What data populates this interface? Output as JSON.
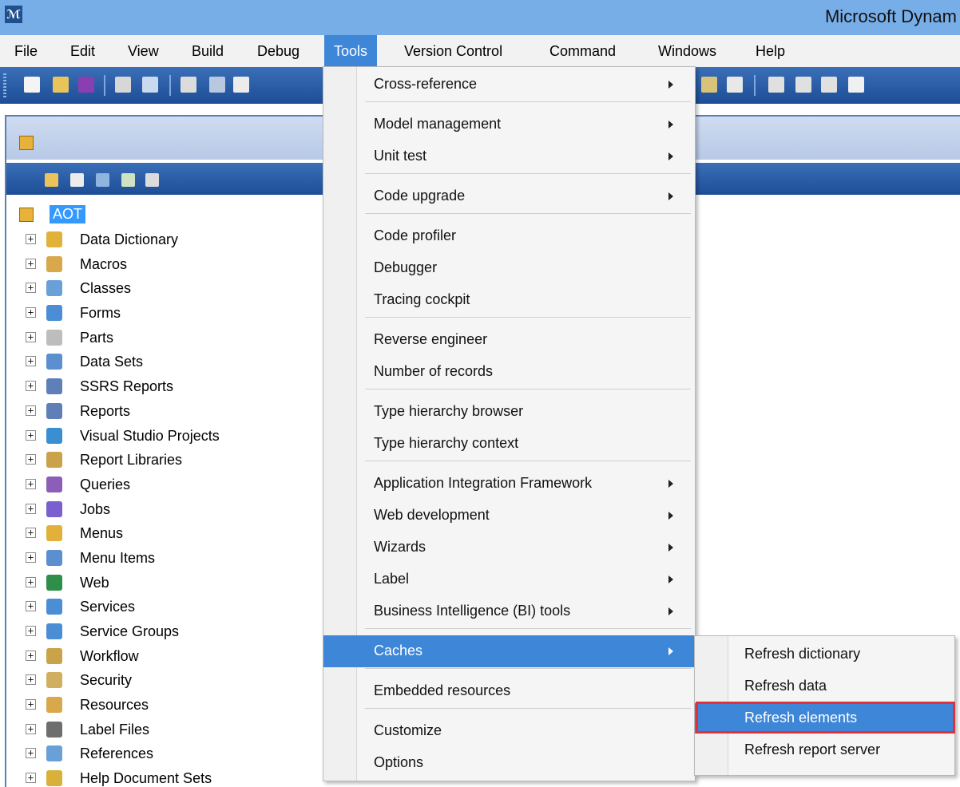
{
  "window": {
    "title": "Microsoft Dynam"
  },
  "menubar": [
    "File",
    "Edit",
    "View",
    "Build",
    "Debug",
    "Tools",
    "Version Control",
    "Command",
    "Windows",
    "Help"
  ],
  "aot": {
    "root_label": "AOT",
    "nodes": [
      {
        "label": "Data Dictionary",
        "icon": "database-icon"
      },
      {
        "label": "Macros",
        "icon": "macros-icon"
      },
      {
        "label": "Classes",
        "icon": "classes-icon"
      },
      {
        "label": "Forms",
        "icon": "forms-icon"
      },
      {
        "label": "Parts",
        "icon": "parts-icon"
      },
      {
        "label": "Data Sets",
        "icon": "data-sets-icon"
      },
      {
        "label": "SSRS Reports",
        "icon": "ssrs-reports-icon"
      },
      {
        "label": "Reports",
        "icon": "reports-icon"
      },
      {
        "label": "Visual Studio Projects",
        "icon": "visual-studio-icon"
      },
      {
        "label": "Report Libraries",
        "icon": "report-libraries-icon"
      },
      {
        "label": "Queries",
        "icon": "queries-icon"
      },
      {
        "label": "Jobs",
        "icon": "jobs-icon"
      },
      {
        "label": "Menus",
        "icon": "menus-icon"
      },
      {
        "label": "Menu Items",
        "icon": "menu-items-icon"
      },
      {
        "label": "Web",
        "icon": "globe-icon"
      },
      {
        "label": "Services",
        "icon": "services-icon"
      },
      {
        "label": "Service Groups",
        "icon": "service-groups-icon"
      },
      {
        "label": "Workflow",
        "icon": "workflow-icon"
      },
      {
        "label": "Security",
        "icon": "security-icon"
      },
      {
        "label": "Resources",
        "icon": "resources-icon"
      },
      {
        "label": "Label Files",
        "icon": "label-files-icon"
      },
      {
        "label": "References",
        "icon": "references-icon"
      },
      {
        "label": "Help Document Sets",
        "icon": "help-documents-icon"
      }
    ]
  },
  "tools_menu": {
    "items": [
      {
        "label": "Cross-reference",
        "submenu": true
      },
      {
        "label": "Model management",
        "submenu": true
      },
      {
        "label": "Unit test",
        "submenu": true
      },
      {
        "label": "Code upgrade",
        "submenu": true
      },
      {
        "label": "Code profiler",
        "submenu": false
      },
      {
        "label": "Debugger",
        "submenu": false
      },
      {
        "label": "Tracing cockpit",
        "submenu": false
      },
      {
        "label": "Reverse engineer",
        "submenu": false
      },
      {
        "label": "Number of records",
        "submenu": false
      },
      {
        "label": "Type hierarchy browser",
        "submenu": false
      },
      {
        "label": "Type hierarchy context",
        "submenu": false
      },
      {
        "label": "Application Integration Framework",
        "submenu": true
      },
      {
        "label": "Web development",
        "submenu": true
      },
      {
        "label": "Wizards",
        "submenu": true
      },
      {
        "label": "Label",
        "submenu": true
      },
      {
        "label": "Business Intelligence (BI) tools",
        "submenu": true
      },
      {
        "label": "Caches",
        "submenu": true,
        "highlighted": true
      },
      {
        "label": "Embedded resources",
        "submenu": false
      },
      {
        "label": "Customize",
        "submenu": false
      },
      {
        "label": "Options",
        "submenu": false
      }
    ]
  },
  "caches_submenu": {
    "items": [
      "Refresh dictionary",
      "Refresh data",
      "Refresh elements",
      "Refresh report server"
    ],
    "highlighted": "Refresh elements"
  },
  "colors": {
    "accent": "#3d86d8",
    "callout": "#e0303a",
    "titlebar": "#78aee8",
    "toolbar": "#1d4d96"
  }
}
